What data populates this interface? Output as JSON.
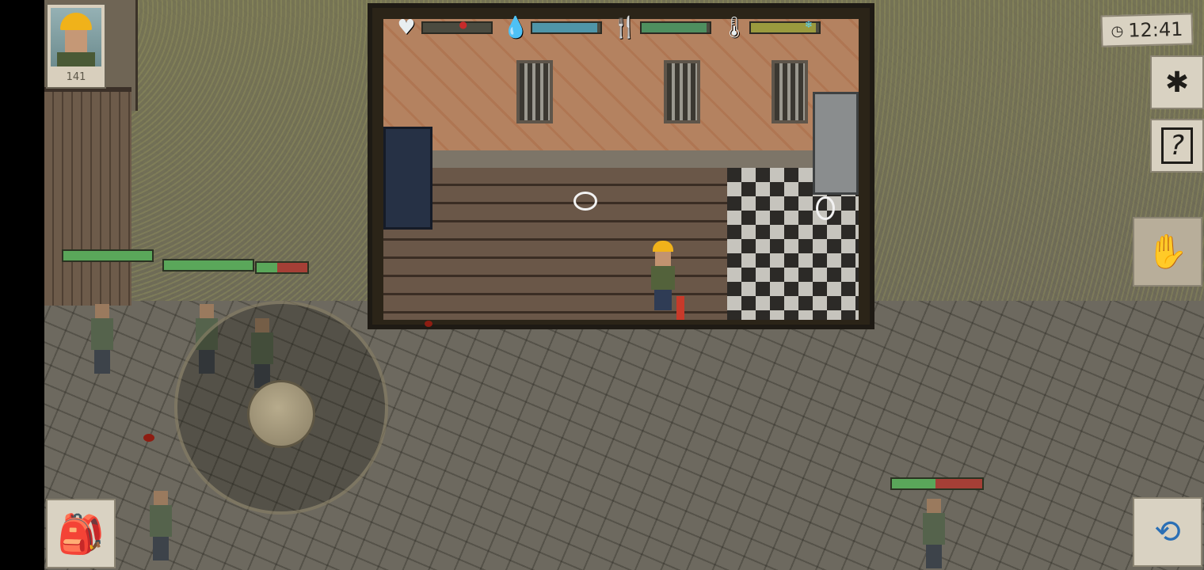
{
  "hud": {
    "stats": [
      {
        "icon": "heart-icon",
        "glyph": "♥",
        "fill": 0.0,
        "color": "#c44a3d",
        "marker": ""
      },
      {
        "icon": "water-drop-icon",
        "glyph": "💧",
        "fill": 0.95,
        "color": "#4f95a8",
        "marker": ""
      },
      {
        "icon": "fork-knife-icon",
        "glyph": "🍴",
        "fill": 0.95,
        "color": "#4e8f5f",
        "marker": ""
      },
      {
        "icon": "thermometer-icon",
        "glyph": "🌡",
        "fill": 0.95,
        "color": "#9a9a3e",
        "marker": "❄"
      }
    ]
  },
  "portrait": {
    "value": "141"
  },
  "clock": {
    "time": "12:41",
    "icon": "clock-icon"
  },
  "side_buttons": [
    {
      "name": "settings-button",
      "icon": "gear-icon",
      "glyph": "✱"
    },
    {
      "name": "quest-journal-button",
      "icon": "journal-icon",
      "glyph": "?"
    },
    {
      "name": "grab-hand-button",
      "icon": "hand-icon",
      "glyph": "✋"
    },
    {
      "name": "backpack-button",
      "icon": "backpack-icon",
      "glyph": "🎒"
    },
    {
      "name": "swap-weapon-button",
      "icon": "swap-weapon-icon",
      "glyph": "⟲"
    }
  ],
  "enemy_health": [
    {
      "fill": 1.0
    },
    {
      "fill": 1.0
    },
    {
      "fill": 0.4
    },
    {
      "fill": 0.48
    }
  ],
  "colors": {
    "health_green": "#5aa75a",
    "health_red": "#a53f36"
  }
}
